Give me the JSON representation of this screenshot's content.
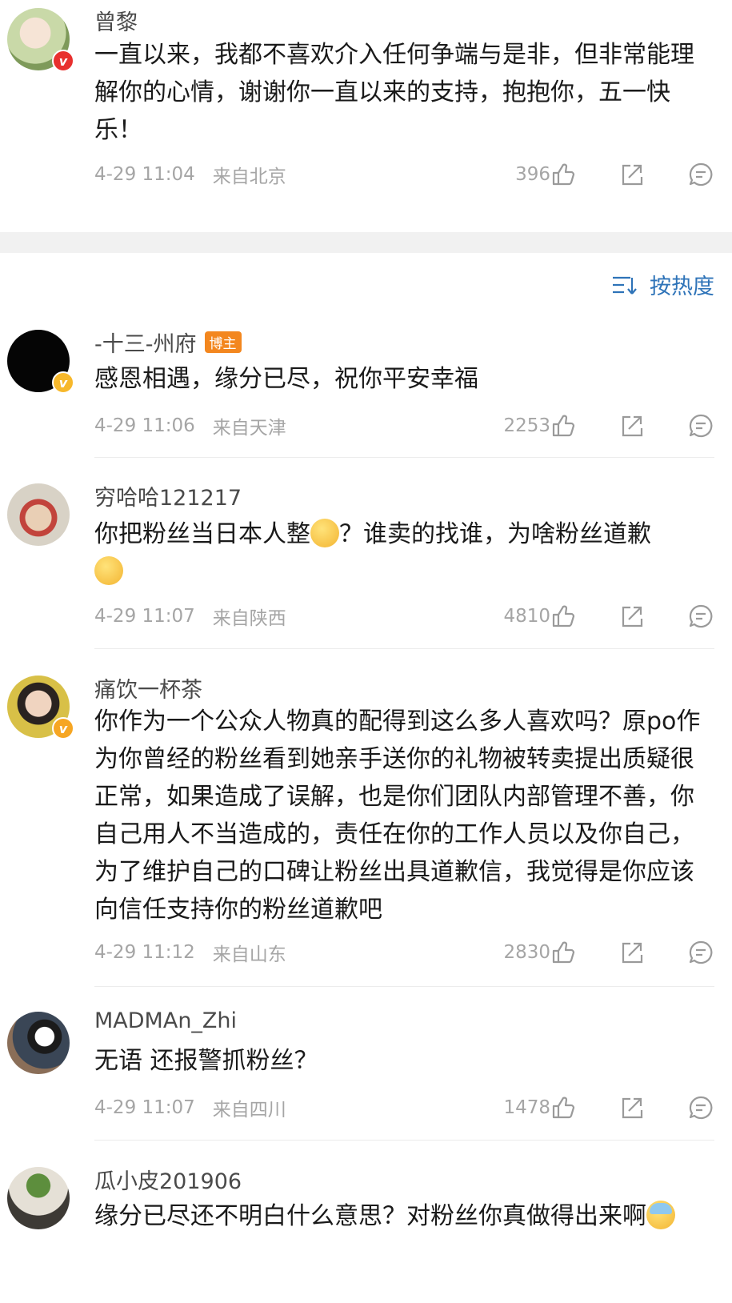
{
  "post": {
    "author": "曾黎",
    "text": "一直以来，我都不喜欢介入任何争端与是非，但非常能理解你的心情，谢谢你一直以来的支持，抱抱你，五一快乐！",
    "time": "4-29 11:04",
    "location": "来自北京",
    "likes": "396"
  },
  "sort": {
    "label": "按热度",
    "icon": "sort-icon"
  },
  "comments": [
    {
      "user": "-十三-州府",
      "tag": "博主",
      "text": "感恩相遇，缘分已尽，祝你平安幸福",
      "time": "4-29 11:06",
      "location": "来自天津",
      "likes": "2253"
    },
    {
      "user": "穷哈哈121217",
      "text_a": "你把粉丝当日本人整",
      "text_b": "？谁卖的找谁，为啥粉丝道歉",
      "time": "4-29 11:07",
      "location": "来自陕西",
      "likes": "4810"
    },
    {
      "user": "痛饮一杯茶",
      "text": "你作为一个公众人物真的配得到这么多人喜欢吗？原po作为你曾经的粉丝看到她亲手送你的礼物被转卖提出质疑很正常，如果造成了误解，也是你们团队内部管理不善，你自己用人不当造成的，责任在你的工作人员以及你自己，为了维护自己的口碑让粉丝出具道歉信，我觉得是你应该向信任支持你的粉丝道歉吧",
      "time": "4-29 11:12",
      "location": "来自山东",
      "likes": "2830"
    },
    {
      "user": "MADMAn_Zhi",
      "text": "无语 还报警抓粉丝？",
      "time": "4-29 11:07",
      "location": "来自四川",
      "likes": "1478"
    },
    {
      "user": "瓜小皮201906",
      "text": "缘分已尽还不明白什么意思？对粉丝你真做得出来啊"
    }
  ],
  "colors": {
    "link_blue": "#2e73b8",
    "meta_gray": "#a5a5a5",
    "tag_orange": "#f3871f"
  }
}
